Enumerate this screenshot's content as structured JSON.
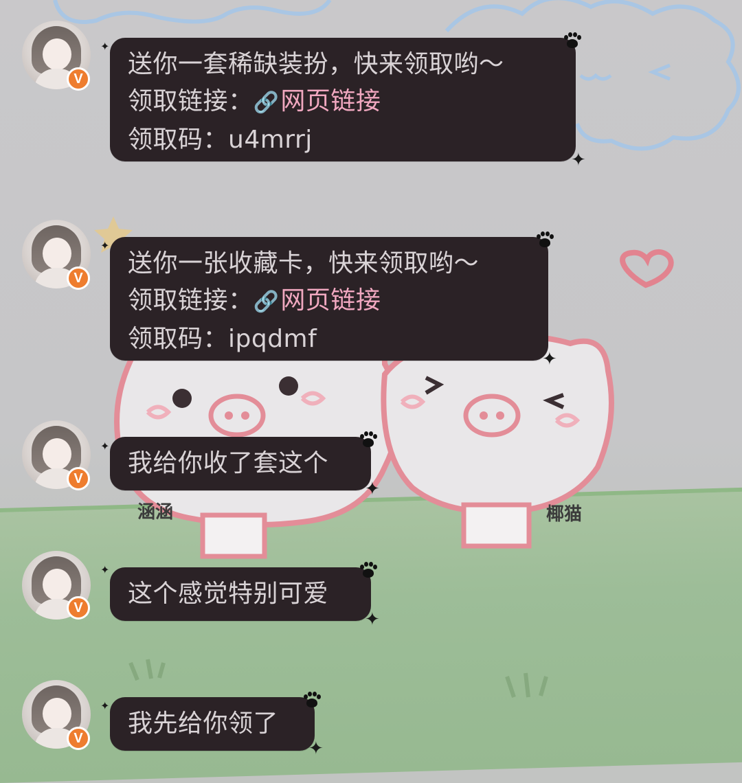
{
  "messages": [
    {
      "lines": [
        {
          "text": "送你一套稀缺装扮，快来领取哟～"
        },
        {
          "label": "领取链接：",
          "link_icon": "🔗",
          "link": "网页链接"
        },
        {
          "text": "领取码：u4mrrj"
        }
      ]
    },
    {
      "lines": [
        {
          "text": "送你一张收藏卡，快来领取哟～"
        },
        {
          "label": "领取链接：",
          "link_icon": "🔗",
          "link": "网页链接"
        },
        {
          "text": "领取码：ipqdmf"
        }
      ]
    },
    {
      "lines": [
        {
          "text": "我给你收了套这个"
        }
      ]
    },
    {
      "lines": [
        {
          "text": "这个感觉特别可爱"
        }
      ]
    },
    {
      "lines": [
        {
          "text": "我先给你领了"
        }
      ]
    }
  ],
  "badge_text": "V",
  "background": {
    "signature_left": "涵涵",
    "signature_right": "椰猫"
  },
  "colors": {
    "bubble": "#2b2226",
    "bubble_text": "#d9d3d6",
    "link": "#f1a8c0",
    "badge": "#ee7d2f"
  },
  "icons": [
    "avatar",
    "verified-badge-icon",
    "link-icon",
    "paw-print-icon",
    "sparkle-icon"
  ]
}
